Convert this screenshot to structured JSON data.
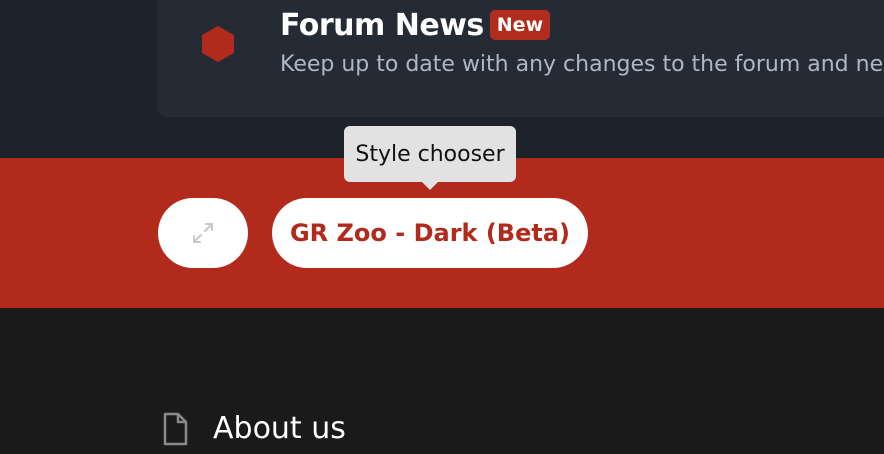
{
  "forum_news": {
    "title": "Forum News",
    "badge": "New",
    "description": "Keep up to date with any changes to the forum and new",
    "icon": "hexagon-icon"
  },
  "tooltip": {
    "text": "Style chooser"
  },
  "controls": {
    "expand_icon": "expand-arrows-icon",
    "style_label": "GR Zoo - Dark (Beta)"
  },
  "footer": {
    "about_title": "About us",
    "about_icon": "document-icon"
  },
  "colors": {
    "accent_red": "#b12a1b",
    "top_bg": "#1e232b",
    "card_bg": "#252b35",
    "footer_bg": "#1a1a1b",
    "tooltip_bg": "#e2e2e2",
    "description_text": "#aeb7c4"
  }
}
